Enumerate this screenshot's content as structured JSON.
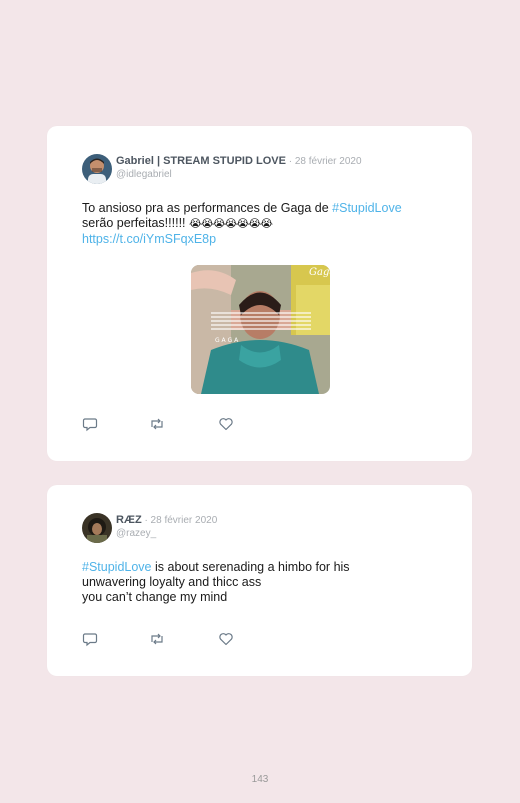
{
  "tweets": [
    {
      "name": "Gabriel | STREAM STUPID LOVE",
      "date": " · 28 février 2020",
      "handle": "@idlegabriel",
      "text_plain": "To ansioso pra as performances de Gaga de ",
      "hashtag": "#StupidLove",
      "text_line2": "serão perfeitas!!!!!! ",
      "emojis": "😭😭😭😭😭😭😭",
      "link": "https://t.co/iYmSFqxE8p",
      "media": {
        "watermark": "Gaga",
        "caption": "G A G A"
      }
    },
    {
      "name": "RÆZ",
      "date": " · 28 février 2020",
      "handle": "@razey_",
      "hashtag": "#StupidLove",
      "text_after_hashtag": " is about serenading a himbo for his",
      "text_line2": "unwavering loyalty and thicc ass",
      "text_line3": "you can’t change my mind"
    }
  ],
  "actions": {
    "reply": "reply-icon",
    "retweet": "retweet-icon",
    "like": "heart-icon"
  },
  "colors": {
    "background": "#f3e6e9",
    "card": "#ffffff",
    "link": "#4fb3e8",
    "muted": "#a9adb2"
  },
  "page_number": "143"
}
